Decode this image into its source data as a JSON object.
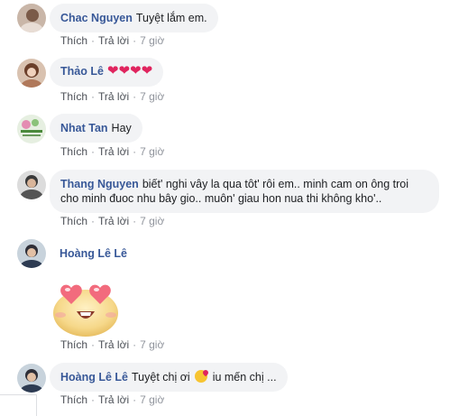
{
  "comments": [
    {
      "name": "Chac Nguyen",
      "text": "Tuyệt lắm em.",
      "like": "Thích",
      "reply": "Trả lời",
      "time": "7 giờ"
    },
    {
      "name": "Thảo Lê",
      "text": "❤❤❤❤",
      "like": "Thích",
      "reply": "Trả lời",
      "time": "7 giờ"
    },
    {
      "name": "Nhat Tan",
      "text": "Hay",
      "like": "Thích",
      "reply": "Trả lời",
      "time": "7 giờ"
    },
    {
      "name": "Thang Nguyen",
      "text": "biết' nghi vây la qua tôt' rôi em.. minh cam on ông troi cho minh đuoc nhu bây gio.. muôn' giau hon nua thi không kho'..",
      "like": "Thích",
      "reply": "Trả lời",
      "time": "7 giờ"
    },
    {
      "name": "Hoàng Lê Lê",
      "text": "",
      "sticker": "heart-eyes-sticker",
      "like": "Thích",
      "reply": "Trả lời",
      "time": "7 giờ"
    },
    {
      "name": "Hoàng Lê Lê",
      "text_before": "Tuyệt chị ơi",
      "text_after": "iu mến chị ...",
      "emoji": "kissing-heart-emoji",
      "like": "Thích",
      "reply": "Trả lời",
      "time": "7 giờ"
    }
  ],
  "colors": {
    "name": "#385898",
    "bubble": "#f2f3f5",
    "meta": "#90949c",
    "heart": "#e0245e"
  }
}
